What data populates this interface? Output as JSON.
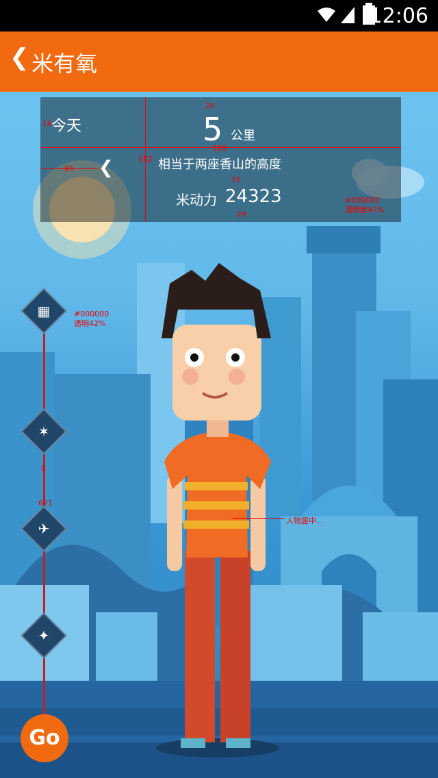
{
  "status_bar": {
    "time": "12:06"
  },
  "app_bar": {
    "back_icon": "❮",
    "title": "米有氧"
  },
  "panel": {
    "today": "今天",
    "distance": "5",
    "unit": "公里",
    "compare": "相当于两座香山的高度",
    "power_label": "米动力",
    "power_value": "24323",
    "prev_icon": "❮"
  },
  "annotations": {
    "a16": "16",
    "a26": "26",
    "a526": "526",
    "a182": "182",
    "a85": "85",
    "a31": "31",
    "a24": "24",
    "panel_color": "#000000",
    "panel_opacity": "透明度42%",
    "timeline_color": "#000000",
    "timeline_opacity": "透明42%",
    "a8": "8",
    "a621": "621",
    "character_note": "人物居中..."
  },
  "go_label": "Go",
  "colors": {
    "accent": "#f26a10",
    "panel": "#000000",
    "timeline": "#c41e1e"
  }
}
